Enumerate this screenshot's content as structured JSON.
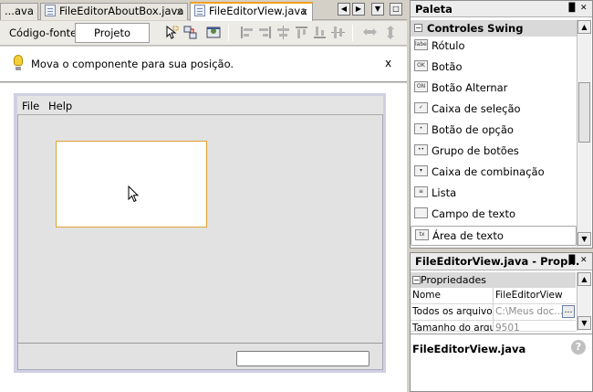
{
  "editor_tabs": [
    {
      "label": "...ava"
    },
    {
      "label": "FileEditorAboutBox.java",
      "close": "x"
    },
    {
      "label": "FileEditorView.java",
      "close": "x"
    }
  ],
  "toolbar": {
    "source_label": "Código-fonte",
    "design_label": "Projeto"
  },
  "hint": {
    "text": "Mova o componente para sua posição.",
    "close": "x"
  },
  "form": {
    "menu": [
      "File",
      "Help"
    ]
  },
  "palette": {
    "title": "Paleta",
    "category": "Controles Swing",
    "items": [
      {
        "label": "Rótulo",
        "icon_text": "label"
      },
      {
        "label": "Botão",
        "icon_text": "OK"
      },
      {
        "label": "Botão Alternar",
        "icon_text": "ON"
      },
      {
        "label": "Caixa de seleção",
        "icon_text": "✓"
      },
      {
        "label": "Botão de opção",
        "icon_text": "•"
      },
      {
        "label": "Grupo de botões",
        "icon_text": "••"
      },
      {
        "label": "Caixa de combinação",
        "icon_text": "▾"
      },
      {
        "label": "Lista",
        "icon_text": "≡"
      },
      {
        "label": "Campo de texto",
        "icon_text": ""
      },
      {
        "label": "Área de texto",
        "icon_text": "tx"
      }
    ]
  },
  "properties": {
    "title": "FileEditorView.java - Prop...",
    "category": "Propriedades",
    "rows": [
      {
        "key": "Nome",
        "value": "FileEditorView"
      },
      {
        "key": "Todos os arquivos",
        "value": "C:\\Meus doc..."
      },
      {
        "key": "Tamanho do arquivo",
        "value": "9501"
      }
    ],
    "description_title": "FileEditorView.java",
    "help": "?"
  },
  "colors": {
    "selection_border": "#e0a030",
    "active_tab_accent": "#f0a020"
  }
}
